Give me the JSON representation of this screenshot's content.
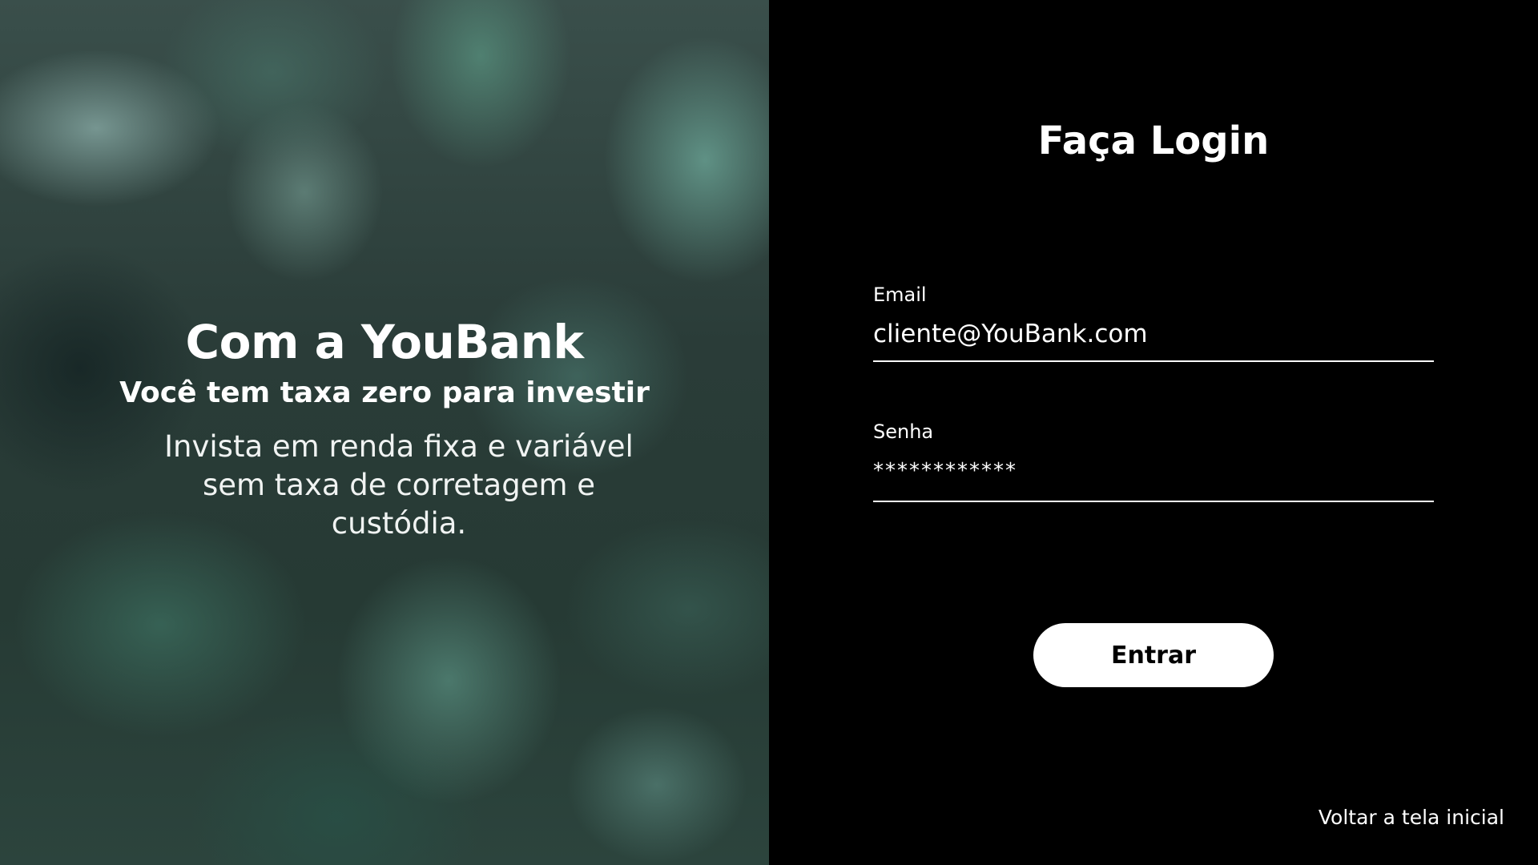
{
  "hero": {
    "title": "Com a YouBank",
    "subtitle": "Você tem taxa zero para investir",
    "body": "Invista em renda fixa e variável sem taxa de corretagem e custódia."
  },
  "login": {
    "title": "Faça Login",
    "email": {
      "label": "Email",
      "value": "cliente@YouBank.com"
    },
    "password": {
      "label": "Senha",
      "value": "************"
    },
    "submit_label": "Entrar",
    "back_link": "Voltar a tela inicial"
  }
}
